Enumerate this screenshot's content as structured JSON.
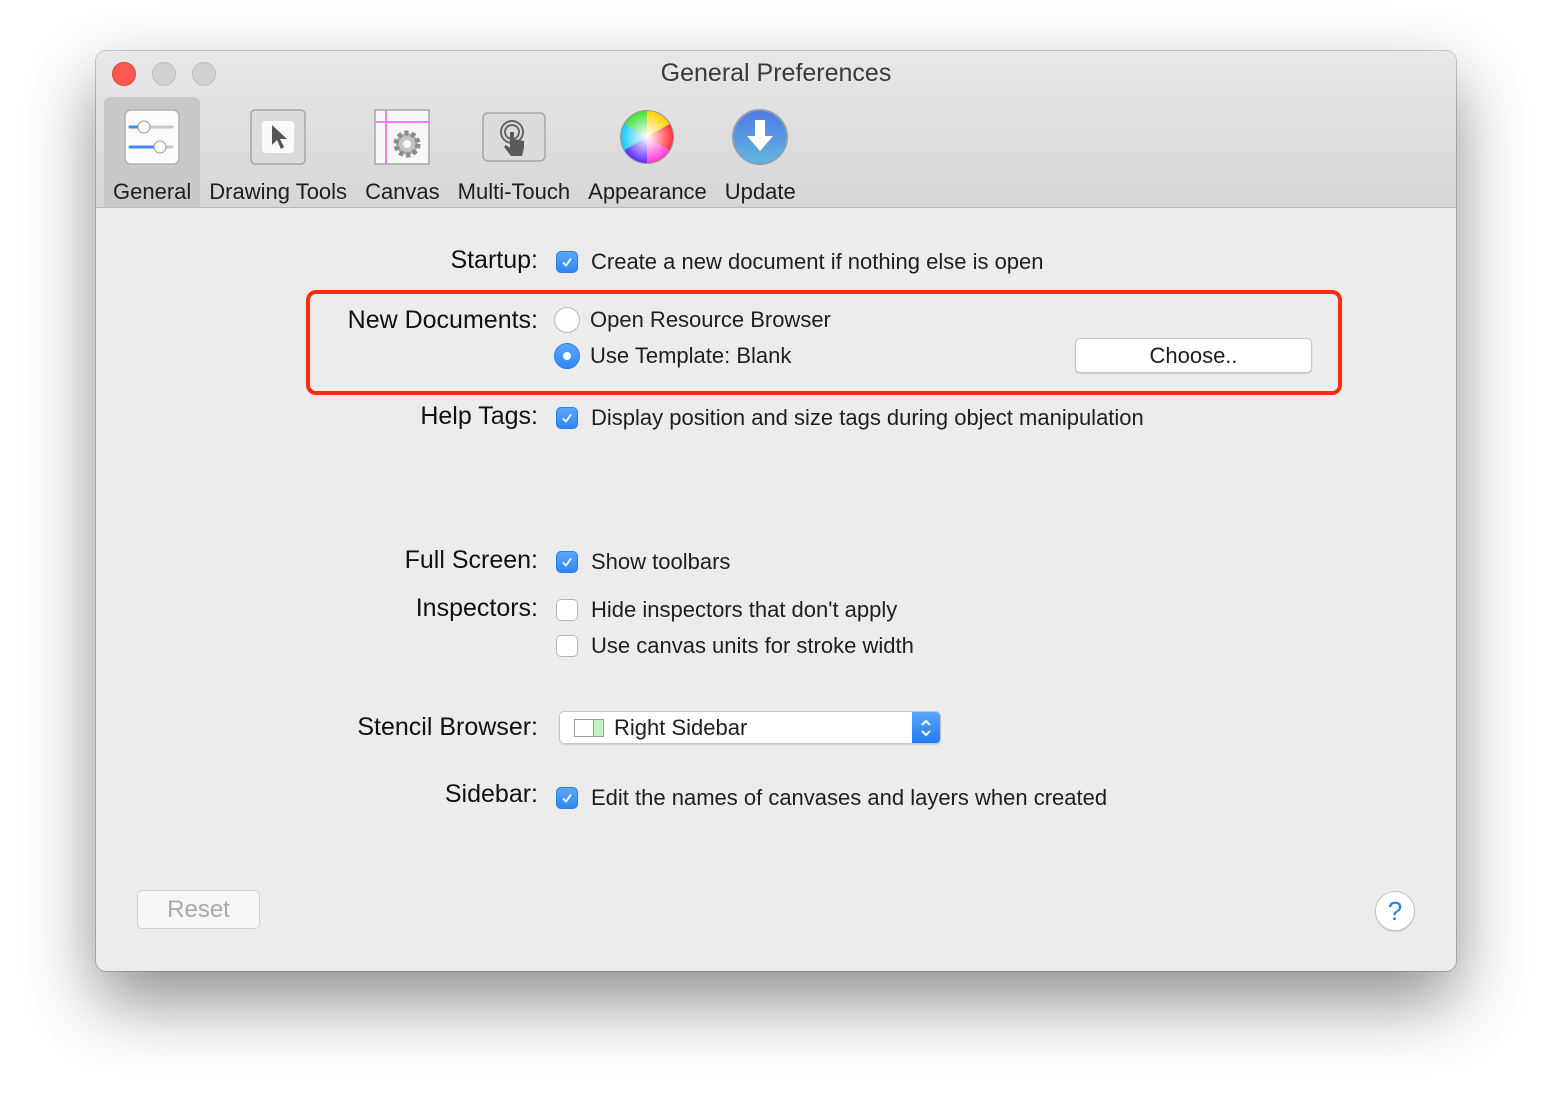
{
  "window": {
    "title": "General Preferences",
    "controls": [
      "close",
      "minimize",
      "zoom"
    ]
  },
  "toolbar": {
    "items": [
      {
        "label": "General",
        "icon": "sliders-icon",
        "active": true
      },
      {
        "label": "Drawing Tools",
        "icon": "pointer-arrow-icon",
        "active": false
      },
      {
        "label": "Canvas",
        "icon": "canvas-gear-icon",
        "active": false
      },
      {
        "label": "Multi-Touch",
        "icon": "touch-hand-icon",
        "active": false
      },
      {
        "label": "Appearance",
        "icon": "color-wheel-icon",
        "active": false
      },
      {
        "label": "Update",
        "icon": "download-arrow-icon",
        "active": false
      }
    ]
  },
  "settings": {
    "startup": {
      "label": "Startup:",
      "option": {
        "text": "Create a new document if nothing else is open",
        "checked": true
      }
    },
    "new_documents": {
      "label": "New Documents:",
      "options": [
        {
          "text": "Open Resource Browser",
          "selected": false
        },
        {
          "text": "Use Template: Blank",
          "selected": true
        }
      ],
      "choose_button": "Choose.."
    },
    "help_tags": {
      "label": "Help Tags:",
      "option": {
        "text": "Display position and size tags during object manipulation",
        "checked": true
      }
    },
    "full_screen": {
      "label": "Full Screen:",
      "option": {
        "text": "Show toolbars",
        "checked": true
      }
    },
    "inspectors": {
      "label": "Inspectors:",
      "options": [
        {
          "text": "Hide inspectors that don't apply",
          "checked": false
        },
        {
          "text": "Use canvas units for stroke width",
          "checked": false
        }
      ]
    },
    "stencil_browser": {
      "label": "Stencil Browser:",
      "selected": "Right Sidebar"
    },
    "sidebar": {
      "label": "Sidebar:",
      "option": {
        "text": "Edit the names of canvases and layers when created",
        "checked": true
      }
    }
  },
  "footer": {
    "reset_label": "Reset",
    "help_label": "?"
  },
  "colors": {
    "accent": "#2f86f4",
    "highlight_box": "#ff2a10",
    "close_button": "#fc5a51"
  }
}
